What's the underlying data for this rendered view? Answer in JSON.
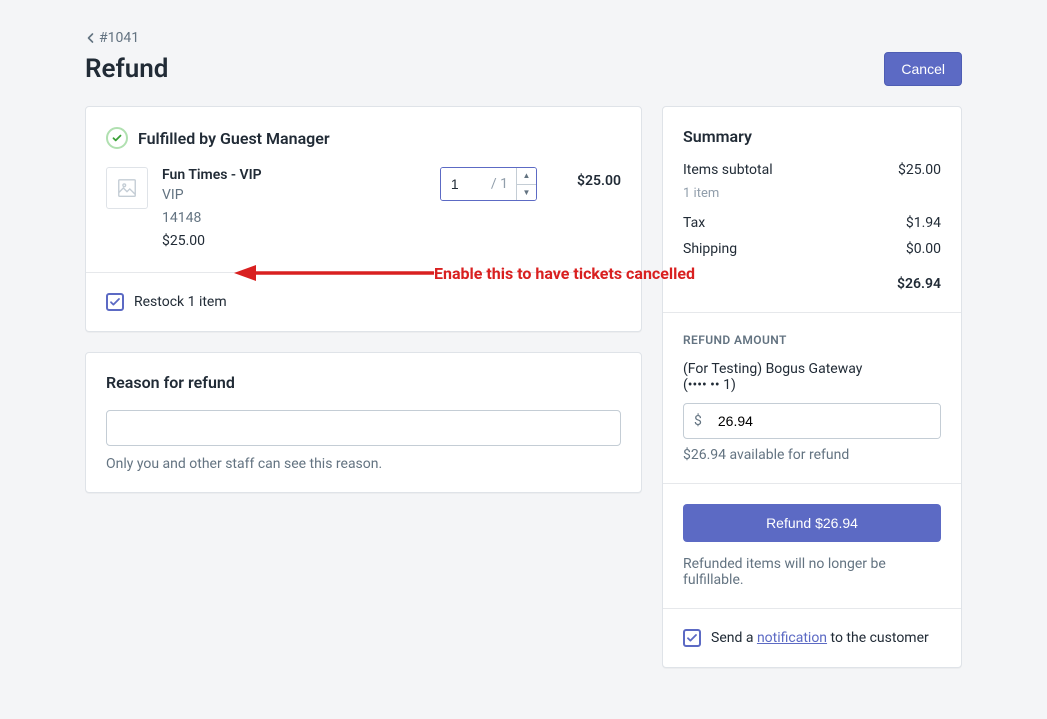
{
  "breadcrumb": {
    "label": "#1041"
  },
  "page": {
    "title": "Refund"
  },
  "actions": {
    "cancel": "Cancel"
  },
  "fulfillment": {
    "header": "Fulfilled by Guest Manager",
    "item": {
      "title": "Fun Times - VIP",
      "variant": "VIP",
      "sku": "14148",
      "price": "$25.00",
      "qty_value": "1",
      "qty_max": "/ 1",
      "line_price": "$25.00"
    },
    "restock_label": "Restock 1 item"
  },
  "annotation": "Enable this to have tickets cancelled",
  "reason": {
    "title": "Reason for refund",
    "placeholder": "",
    "helper": "Only you and other staff can see this reason."
  },
  "summary": {
    "title": "Summary",
    "rows": {
      "subtotal_label": "Items subtotal",
      "subtotal_value": "$25.00",
      "item_count": "1 item",
      "tax_label": "Tax",
      "tax_value": "$1.94",
      "shipping_label": "Shipping",
      "shipping_value": "$0.00",
      "total_value": "$26.94"
    }
  },
  "refund": {
    "section_label": "REFUND AMOUNT",
    "gateway": "(For Testing) Bogus Gateway",
    "card_mask": "(•••• •• 1)",
    "currency": "$",
    "amount": "26.94",
    "available": "$26.94 available for refund",
    "button": "Refund $26.94",
    "note": "Refunded items will no longer be fulfillable.",
    "notify_prefix": "Send a ",
    "notify_link": "notification",
    "notify_suffix": " to the customer"
  }
}
